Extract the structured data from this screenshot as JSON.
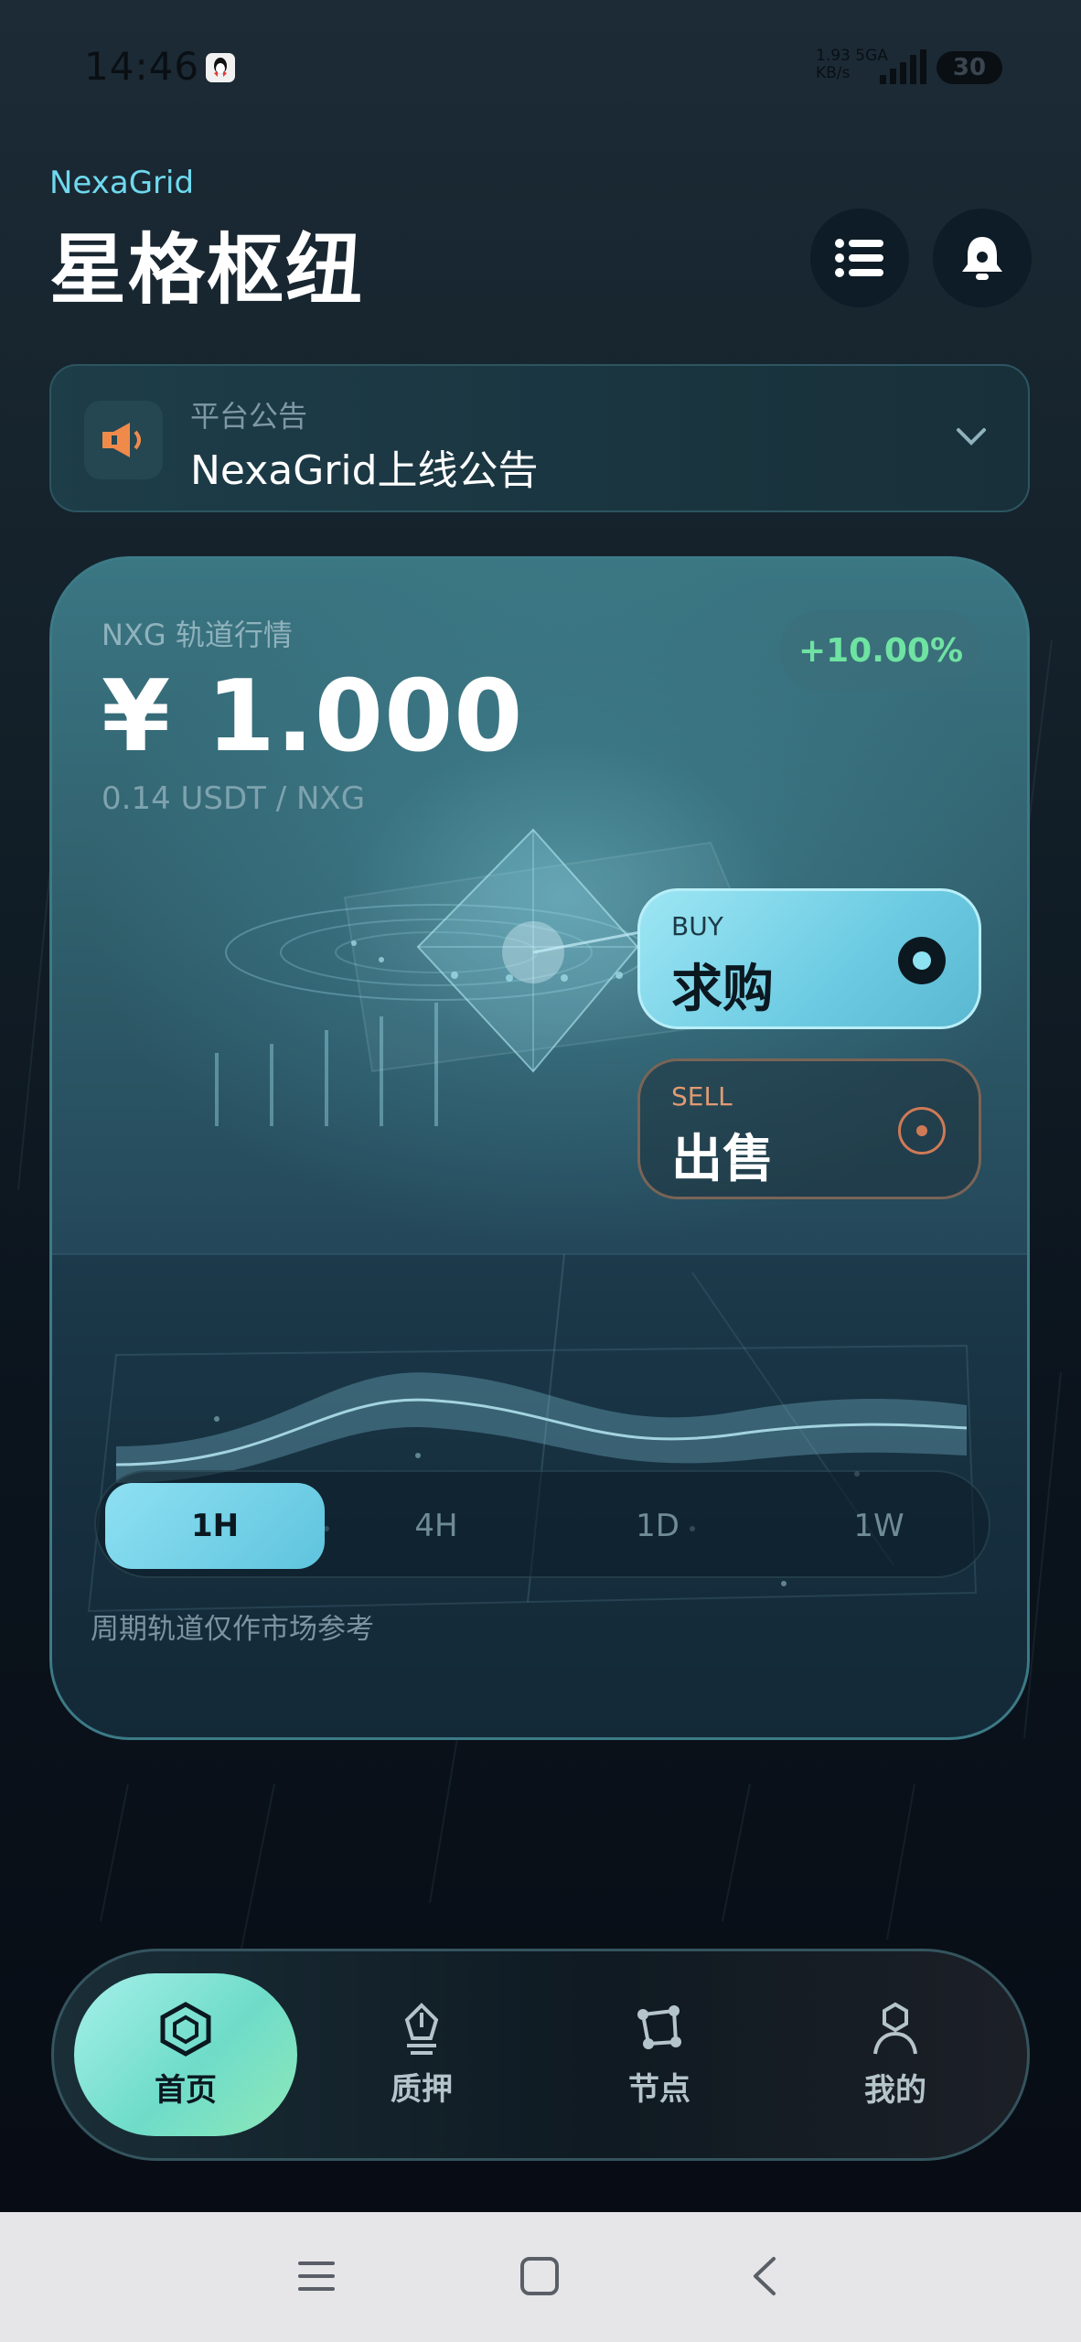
{
  "status_bar": {
    "time": "14:46",
    "net_speed": "1.93",
    "net_unit": "KB/s",
    "net_type": "5GA",
    "battery": "30"
  },
  "header": {
    "brand_en": "NexaGrid",
    "brand_cn": "星格枢纽"
  },
  "announcement": {
    "label": "平台公告",
    "title": "NexaGrid上线公告"
  },
  "market": {
    "label": "NXG 轨道行情",
    "price": "¥ 1.000",
    "price_sub": "0.14 USDT / NXG",
    "change": "+10.00%",
    "buy_tag": "BUY",
    "buy_label": "求购",
    "sell_tag": "SELL",
    "sell_label": "出售",
    "periods": [
      "1H",
      "4H",
      "1D",
      "1W"
    ],
    "active_period": "1H",
    "note": "周期轨道仅作市场参考"
  },
  "nav": {
    "items": [
      {
        "label": "首页",
        "icon": "home-hex-icon",
        "active": true
      },
      {
        "label": "质押",
        "icon": "pledge-icon",
        "active": false
      },
      {
        "label": "节点",
        "icon": "node-icon",
        "active": false
      },
      {
        "label": "我的",
        "icon": "profile-icon",
        "active": false
      }
    ]
  },
  "colors": {
    "accent": "#6fd9ee",
    "positive": "#6fe3a2",
    "sell": "#d07a55",
    "nav_active": "#8de8c8"
  }
}
